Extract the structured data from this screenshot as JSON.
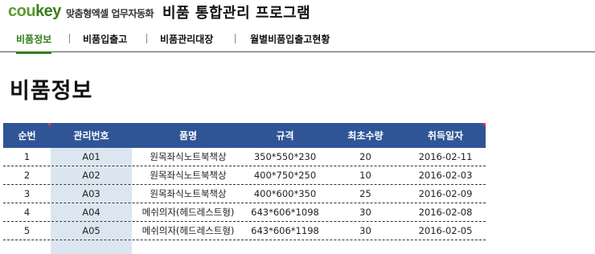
{
  "header": {
    "logo_co": "cou",
    "logo_key": "key",
    "logo_sub": "맞춤형엑셀 업무자동화",
    "app_title": "비품 통합관리 프로그램"
  },
  "nav": {
    "items": [
      {
        "label": "비품정보",
        "active": true
      },
      {
        "label": "비품입출고",
        "active": false
      },
      {
        "label": "비품관리대장",
        "active": false
      },
      {
        "label": "월별비품입출고현황",
        "active": false
      }
    ]
  },
  "page": {
    "title": "비품정보"
  },
  "table": {
    "columns": [
      "순번",
      "관리번호",
      "품명",
      "규격",
      "최초수량",
      "취득일자"
    ],
    "rows": [
      [
        "1",
        "A01",
        "원목좌식노트북책상",
        "350*550*230",
        "20",
        "2016-02-11"
      ],
      [
        "2",
        "A02",
        "원목좌식노트북책상",
        "400*750*250",
        "10",
        "2016-02-03"
      ],
      [
        "3",
        "A03",
        "원목좌식노트북책상",
        "400*600*350",
        "25",
        "2016-02-09"
      ],
      [
        "4",
        "A04",
        "메쉬의자(헤드레스트형)",
        "643*606*1098",
        "30",
        "2016-02-08"
      ],
      [
        "5",
        "A05",
        "메쉬의자(헤드레스트형)",
        "643*606*1198",
        "30",
        "2016-02-05"
      ]
    ]
  },
  "colors": {
    "brand_green": "#3a7d1c",
    "header_blue": "#2f5597",
    "key_column_fill": "#dce6f1",
    "comment_marker": "#e53935"
  }
}
